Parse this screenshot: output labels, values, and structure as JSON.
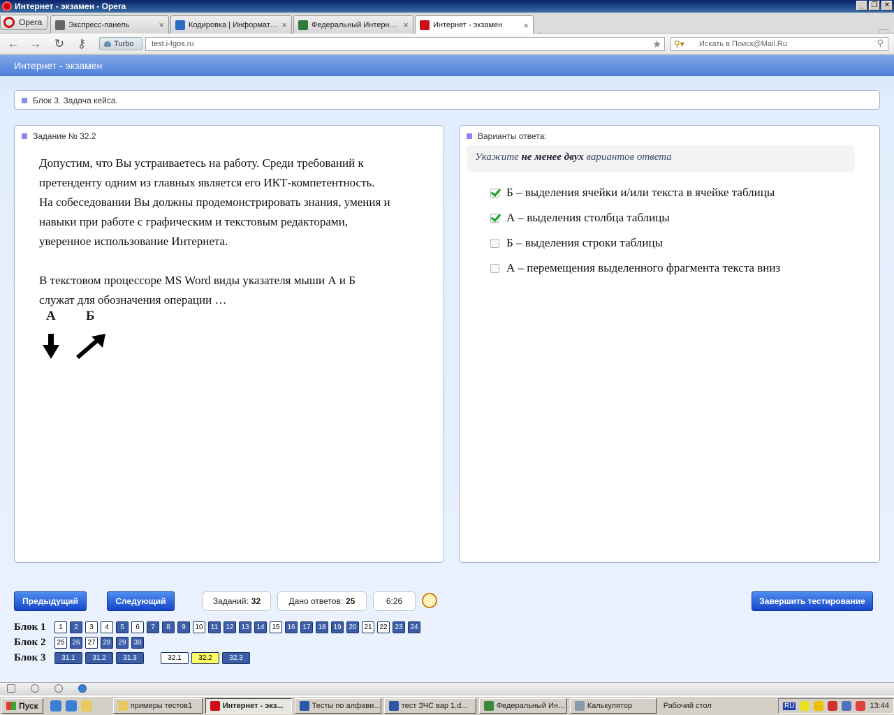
{
  "window": {
    "title": "Интернет - экзамен - Opera"
  },
  "browser": {
    "menu_label": "Opera",
    "tabs": [
      {
        "label": "Экспресс-панель",
        "icon": "grid-icon",
        "close": "×"
      },
      {
        "label": "Кодировка | Информат…",
        "icon": "plus-icon",
        "close": "×"
      },
      {
        "label": "Федеральный Интерне…",
        "icon": "grid-icon",
        "close": "×"
      },
      {
        "label": "Интернет - экзамен",
        "icon": "opera-page-icon",
        "close": "×"
      }
    ],
    "new_tab": "+",
    "turbo_label": "Turbo",
    "url": "test.i-fgos.ru",
    "search_placeholder": "Искать в Поиск@Mail.Ru"
  },
  "page": {
    "header_title": "Интернет - экзамен",
    "block_title": "Блок 3. Задача кейса.",
    "task": {
      "title": "Задание № 32.2",
      "text_lines": [
        "Допустим, что Вы устраиваетесь на работу. Среди требований к",
        "претенденту одним из главных является его ИКТ-компетентность.",
        "На собеседовании Вы должны продемонстрировать знания, умения и",
        "навыки при работе с графическим и текстовым редакторами,",
        "уверенное использование Интернета.",
        "",
        "В текстовом процессоре MS Word виды указателя мыши А и Б",
        "служат для обозначения операции …"
      ],
      "pointer_a_label": "А",
      "pointer_b_label": "Б"
    },
    "answers": {
      "title": "Варианты ответа:",
      "hint_prefix": "Укажите ",
      "hint_bold": "не менее двух",
      "hint_suffix": " вариантов ответа",
      "options": [
        {
          "label": "Б – выделения ячейки и/или текста в ячейке таблицы",
          "checked": true
        },
        {
          "label": "А – выделения столбца таблицы",
          "checked": true
        },
        {
          "label": "Б – выделения строки таблицы",
          "checked": false
        },
        {
          "label": "А – перемещения выделенного фрагмента текста вниз",
          "checked": false
        }
      ]
    },
    "controls": {
      "prev_label": "Предыдущий",
      "next_label": "Следующий",
      "tasks_label": "Заданий:",
      "tasks_count": "32",
      "answered_label": "Дано ответов:",
      "answered_count": "25",
      "timer": "6:26",
      "finish_label": "Завершить тестирование"
    },
    "blocks": [
      {
        "label": "Блок 1",
        "items": [
          {
            "n": "1",
            "state": "white"
          },
          {
            "n": "2",
            "state": "blue"
          },
          {
            "n": "3",
            "state": "white"
          },
          {
            "n": "4",
            "state": "white"
          },
          {
            "n": "5",
            "state": "blue"
          },
          {
            "n": "6",
            "state": "white"
          },
          {
            "n": "7",
            "state": "blue"
          },
          {
            "n": "8",
            "state": "blue"
          },
          {
            "n": "9",
            "state": "blue"
          },
          {
            "n": "10",
            "state": "white"
          },
          {
            "n": "11",
            "state": "blue"
          },
          {
            "n": "12",
            "state": "blue"
          },
          {
            "n": "13",
            "state": "blue"
          },
          {
            "n": "14",
            "state": "blue"
          },
          {
            "n": "15",
            "state": "white"
          },
          {
            "n": "16",
            "state": "blue"
          },
          {
            "n": "17",
            "state": "blue"
          },
          {
            "n": "18",
            "state": "blue"
          },
          {
            "n": "19",
            "state": "blue"
          },
          {
            "n": "20",
            "state": "blue"
          },
          {
            "n": "21",
            "state": "white"
          },
          {
            "n": "22",
            "state": "white"
          },
          {
            "n": "23",
            "state": "blue"
          },
          {
            "n": "24",
            "state": "blue"
          }
        ]
      },
      {
        "label": "Блок 2",
        "items": [
          {
            "n": "25",
            "state": "white"
          },
          {
            "n": "26",
            "state": "blue"
          },
          {
            "n": "27",
            "state": "white"
          },
          {
            "n": "28",
            "state": "blue"
          },
          {
            "n": "29",
            "state": "blue"
          },
          {
            "n": "30",
            "state": "blue"
          }
        ]
      },
      {
        "label": "Блок 3",
        "items": [
          {
            "n": "31.1",
            "state": "blue"
          },
          {
            "n": "31.2",
            "state": "blue"
          },
          {
            "n": "31.3",
            "state": "blue"
          },
          {
            "n": "32.1",
            "state": "white",
            "gap": true
          },
          {
            "n": "32.2",
            "state": "yellow"
          },
          {
            "n": "32.3",
            "state": "blue"
          }
        ]
      }
    ]
  },
  "taskbar": {
    "start_label": "Пуск",
    "items": [
      {
        "label": "примеры тестов1",
        "active": false,
        "color": "#e8c860"
      },
      {
        "label": "Интернет - экз...",
        "active": true,
        "color": "#cc0f16"
      },
      {
        "label": "Тесты по алфави...",
        "active": false,
        "color": "#2b57a6"
      },
      {
        "label": "тест ЗЧС вар 1.d...",
        "active": false,
        "color": "#2b57a6"
      },
      {
        "label": "Федеральный Ин...",
        "active": false,
        "color": "#3a8a3a"
      },
      {
        "label": "Калькулятор",
        "active": false,
        "color": "#8899aa"
      }
    ],
    "desktop_label": "Рабочий стол",
    "lang": "RU",
    "clock": "13:44"
  },
  "colors": {
    "accent_blue": "#1746c9",
    "checkmark_green": "#1aa32a",
    "current_question_yellow": "#ffff66"
  }
}
